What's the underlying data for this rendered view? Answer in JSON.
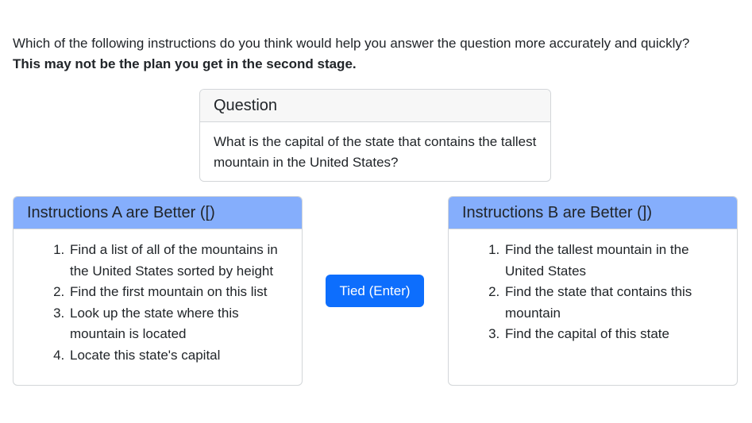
{
  "prompt": {
    "question_text": "Which of the following instructions do you think would help you answer the question more accurately and quickly?",
    "note": "This may not be the plan you get in the second stage."
  },
  "question_card": {
    "title": "Question",
    "text": "What is the capital of the state that contains the tallest mountain in the United States?"
  },
  "option_a": {
    "label": "Instructions A are Better ([)",
    "steps": [
      "Find a list of all of the mountains in the United States sorted by height",
      "Find the first mountain on this list",
      "Look up the state where this mountain is located",
      "Locate this state's capital"
    ]
  },
  "option_b": {
    "label": "Instructions B are Better (])",
    "steps": [
      "Find the tallest mountain in the United States",
      "Find the state that contains this mountain",
      "Find the capital of this state"
    ]
  },
  "tie_button": {
    "label": "Tied (Enter)"
  },
  "colors": {
    "choice_header_bg": "#85aefc",
    "question_header_bg": "#f7f7f7",
    "primary_button": "#0d6efd"
  }
}
